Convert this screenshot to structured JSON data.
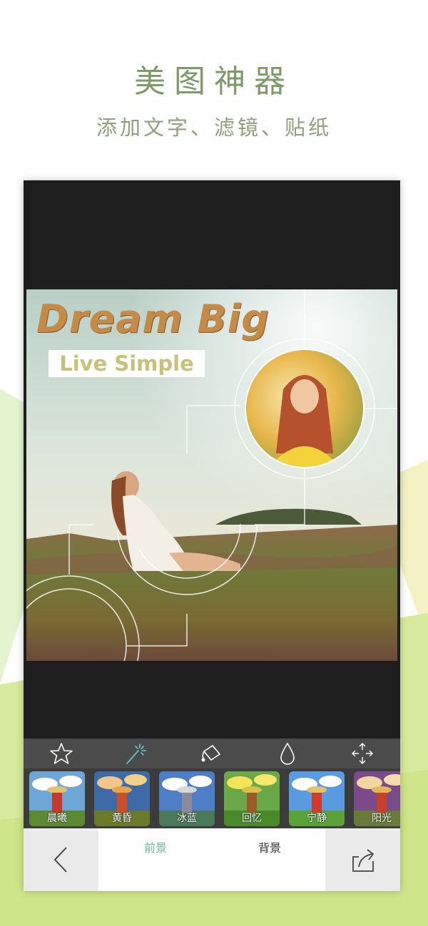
{
  "promo": {
    "headline": "美图神器",
    "subheadline": "添加文字、滤镜、贴纸"
  },
  "canvas": {
    "title_text": "Dream Big",
    "subtitle_text": "Live Simple"
  },
  "toolbar": {
    "tools": [
      {
        "icon": "star-icon"
      },
      {
        "icon": "magic-wand-icon"
      },
      {
        "icon": "paint-bucket-icon"
      },
      {
        "icon": "drop-icon"
      },
      {
        "icon": "move-arrows-icon"
      }
    ]
  },
  "filters": [
    {
      "label": "晨曦"
    },
    {
      "label": "黄昏"
    },
    {
      "label": "冰蓝"
    },
    {
      "label": "回忆"
    },
    {
      "label": "宁静"
    },
    {
      "label": "阳光"
    }
  ],
  "bottom_nav": {
    "back_icon": "chevron-left-icon",
    "share_icon": "share-icon",
    "tab_foreground": "前景",
    "tab_background": "背景",
    "active_tab_color": "#6fb89b"
  }
}
